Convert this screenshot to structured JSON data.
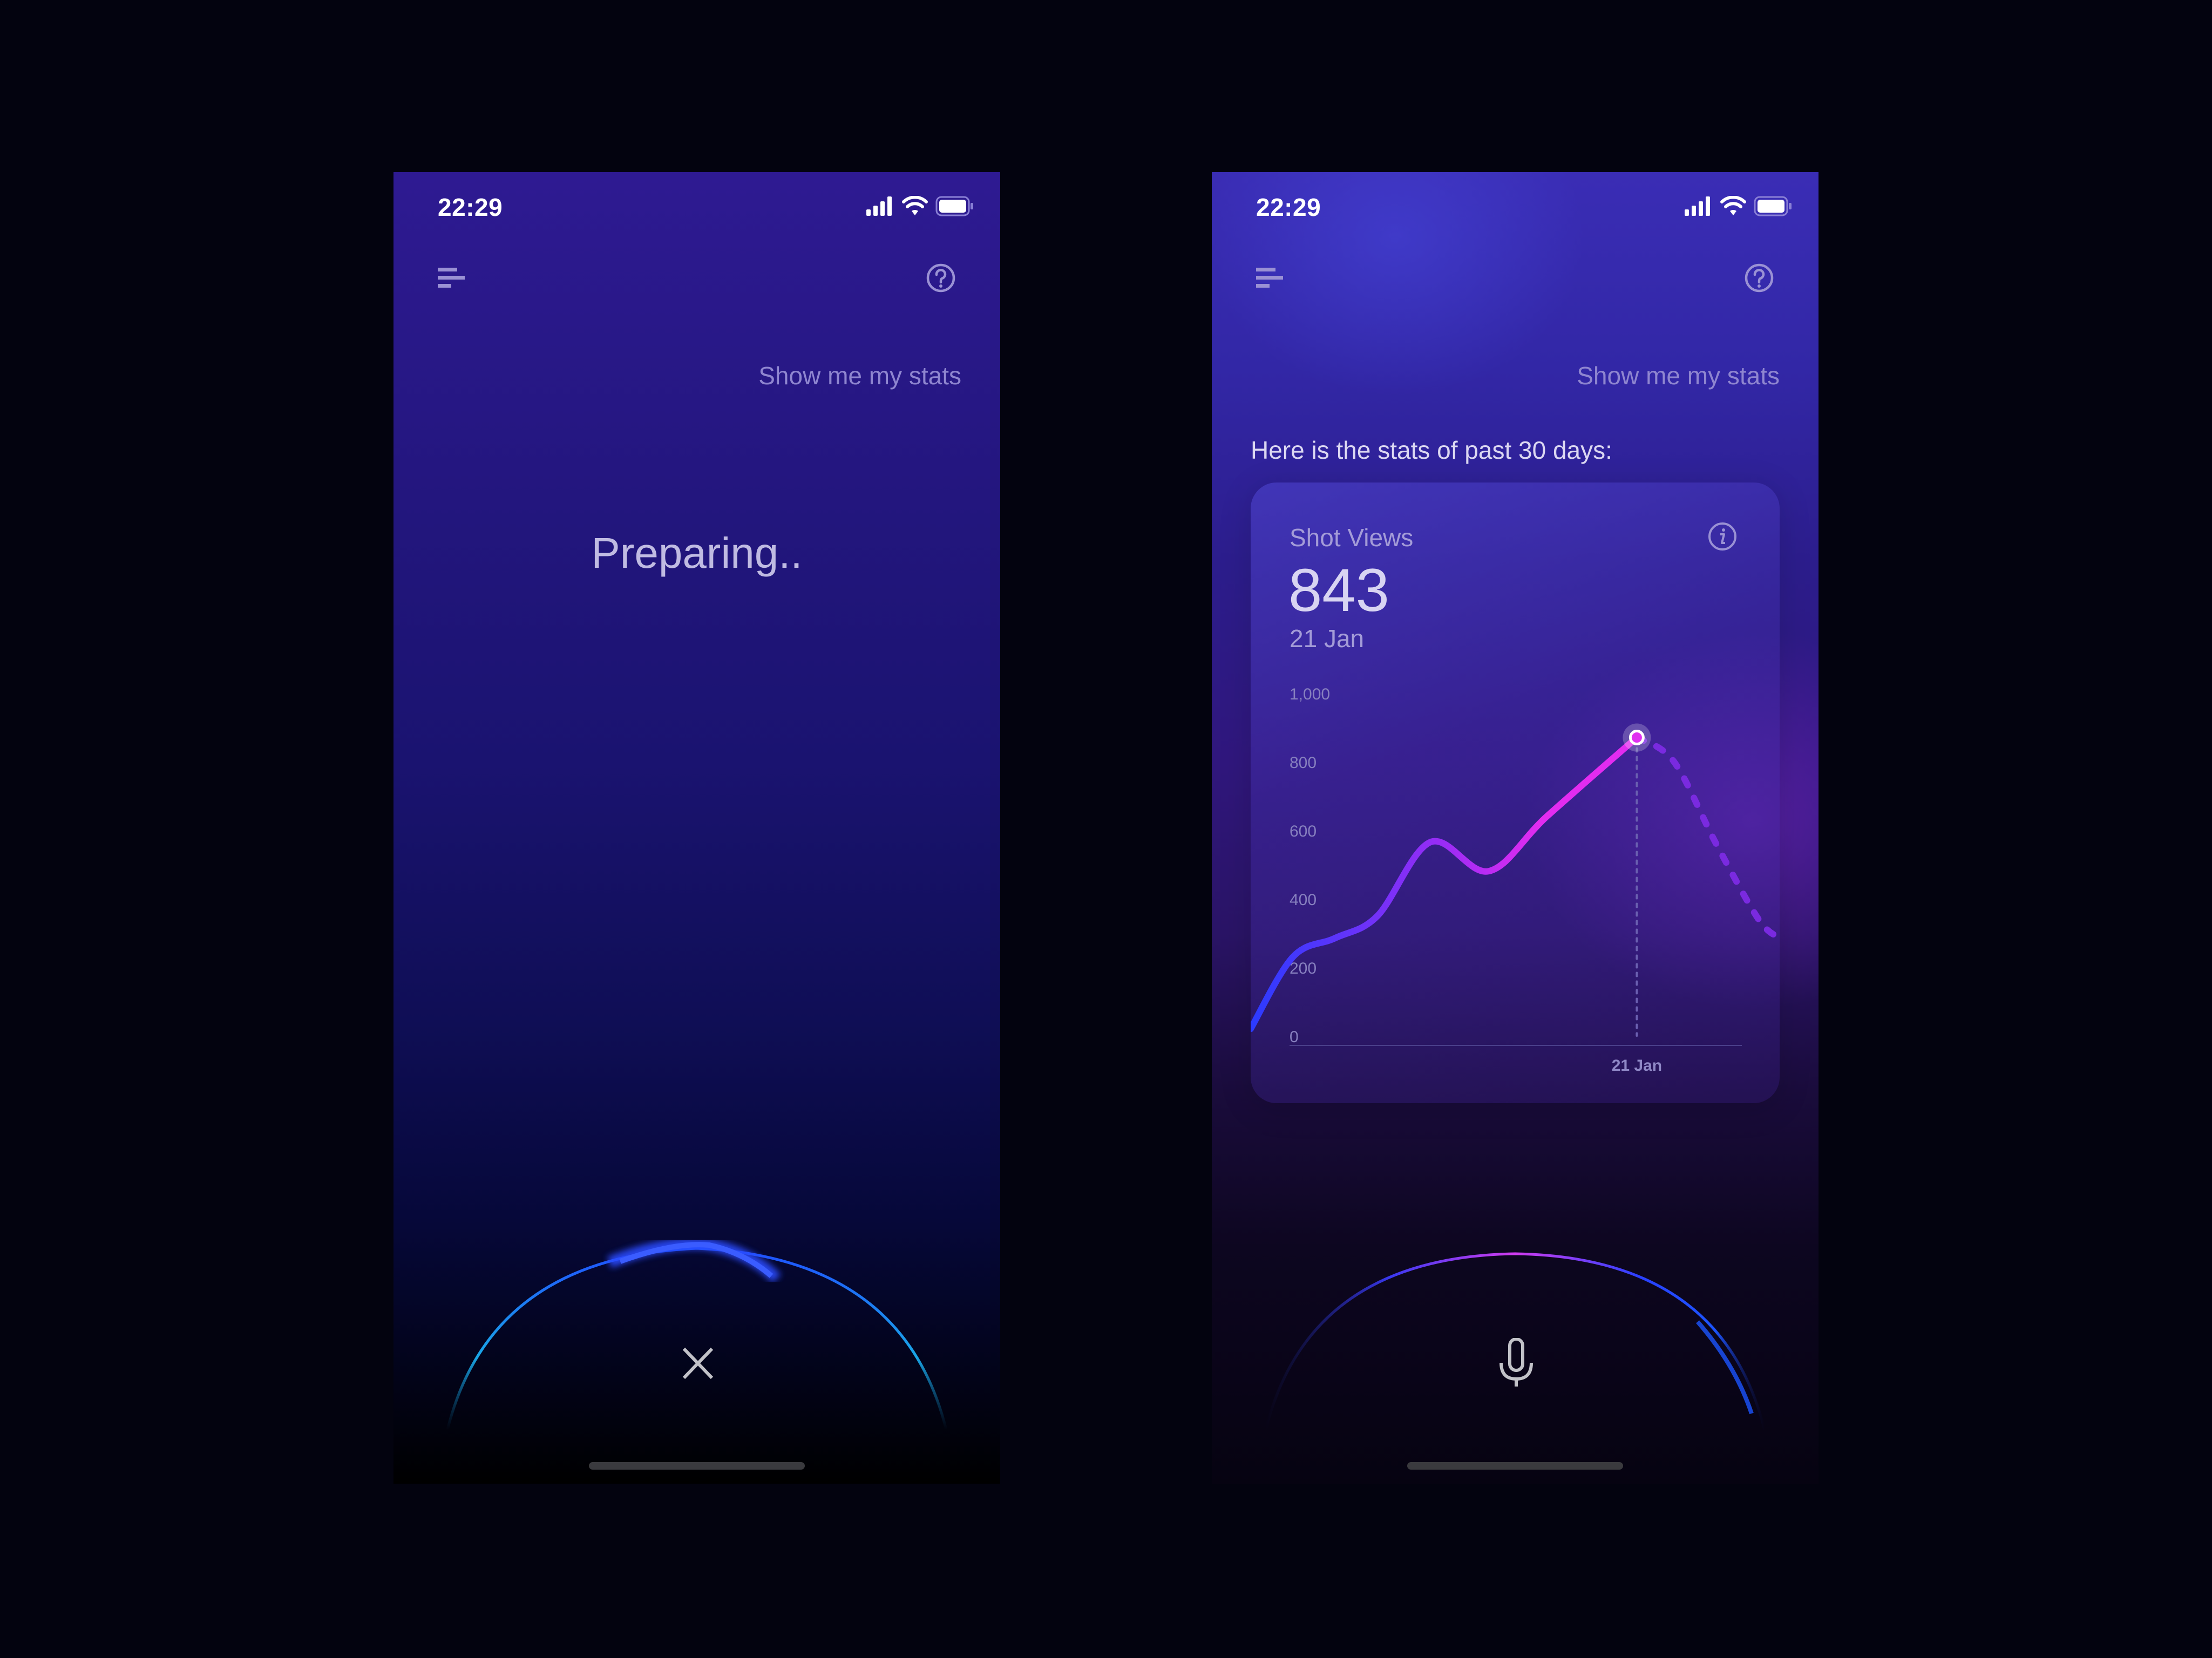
{
  "screens": [
    {
      "id": "preparing",
      "status_bar": {
        "time": "22:29",
        "icons": [
          "signal-icon",
          "wifi-icon",
          "battery-icon"
        ]
      },
      "header": {
        "menu_icon": "menu-icon",
        "help_icon": "help-icon"
      },
      "user_query": "Show me my stats",
      "status_text": "Preparing..",
      "bottom_action": {
        "icon": "close-icon",
        "label": "Cancel"
      }
    },
    {
      "id": "stats",
      "status_bar": {
        "time": "22:29",
        "icons": [
          "signal-icon",
          "wifi-icon",
          "battery-icon"
        ]
      },
      "header": {
        "menu_icon": "menu-icon",
        "help_icon": "help-icon"
      },
      "user_query": "Show me my stats",
      "assistant_message": "Here is the stats of past 30 days:",
      "card": {
        "title": "Shot Views",
        "value": "843",
        "date": "21 Jan",
        "info_icon": "info-icon"
      },
      "bottom_action": {
        "icon": "microphone-icon",
        "label": "Speak"
      }
    }
  ],
  "colors": {
    "line_start": "#2b3bff",
    "line_mid": "#9a2cf5",
    "line_end": "#e22cf0",
    "dashed_projection": "#7a2ae0",
    "marker_fill": "#e030f0",
    "arc_blue": "#1e5bff",
    "arc_magenta": "#d23cf0"
  },
  "chart_data": {
    "type": "line",
    "title": "Shot Views",
    "xlabel": "",
    "ylabel": "",
    "ylim": [
      0,
      1000
    ],
    "yticks": [
      "0",
      "200",
      "400",
      "600",
      "800",
      "1,000"
    ],
    "ytick_values": [
      0,
      200,
      400,
      600,
      800,
      1000
    ],
    "x_tick_labels": [
      {
        "label": "21 Jan",
        "x": 0.73
      }
    ],
    "grid": false,
    "series": [
      {
        "name": "actual",
        "style": "solid",
        "points": [
          [
            0.0,
            20
          ],
          [
            0.08,
            230
          ],
          [
            0.16,
            285
          ],
          [
            0.24,
            350
          ],
          [
            0.34,
            565
          ],
          [
            0.45,
            480
          ],
          [
            0.56,
            640
          ],
          [
            0.73,
            870
          ]
        ]
      },
      {
        "name": "projection",
        "style": "dashed",
        "points": [
          [
            0.73,
            870
          ],
          [
            0.8,
            800
          ],
          [
            0.88,
            560
          ],
          [
            0.96,
            340
          ],
          [
            1.0,
            285
          ]
        ]
      }
    ],
    "highlight": {
      "x": 0.73,
      "value": 843,
      "label": "21 Jan"
    }
  }
}
